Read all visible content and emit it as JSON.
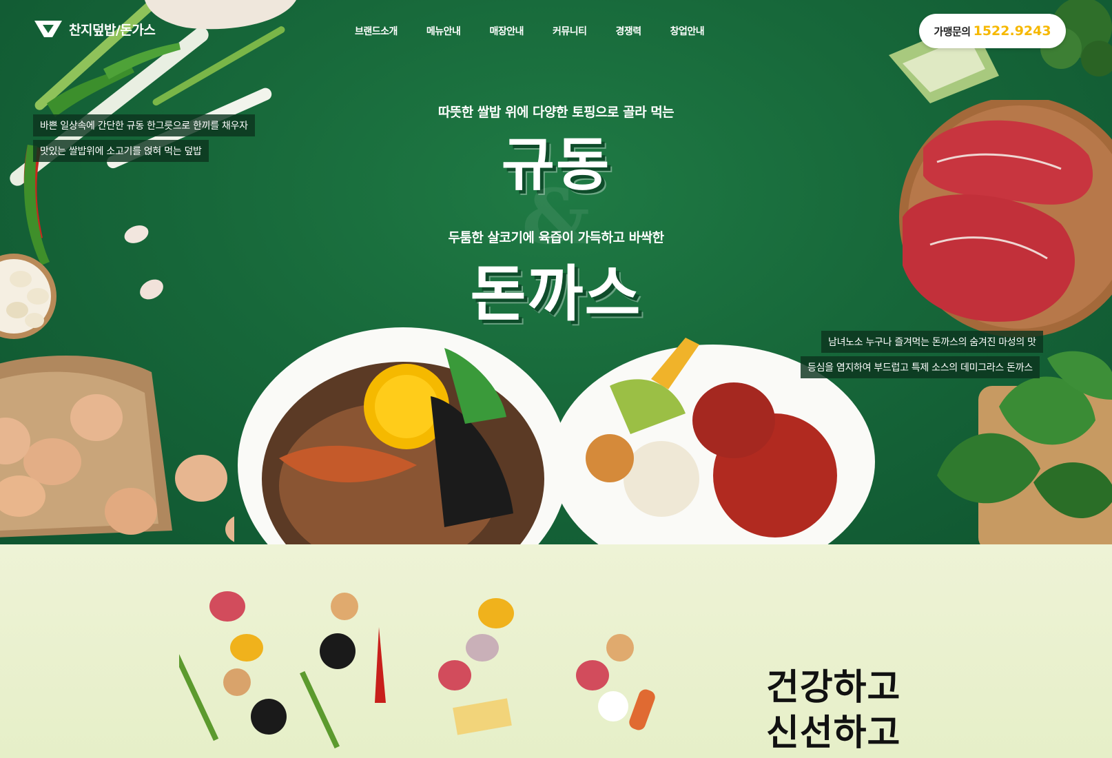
{
  "header": {
    "logo_text": "찬지덮밥/돈가스",
    "nav": [
      "브랜드소개",
      "메뉴안내",
      "매장안내",
      "커뮤니티",
      "경쟁력",
      "창업안내"
    ],
    "franchise_label": "가맹문의",
    "franchise_phone": "1522.9243"
  },
  "hero": {
    "left_taglines": [
      "바쁜 일상속에 간단한 규동 한그릇으로 한끼를 채우자",
      "맛있는 쌀밥위에 소고기를 얹혀 먹는 덮밥"
    ],
    "right_taglines": [
      "남녀노소 누구나 즐겨먹는 돈까스의 숨겨진 마성의 맛",
      "등심을 염지하여 부드럽고 특제 소스의 데미그라스 돈까스"
    ],
    "subtitle1": "따뜻한 쌀밥 위에 다양한 토핑으로 골라 먹는",
    "title1": "규동",
    "ampersand": "&",
    "subtitle2": "두툼한 살코기에 육즙이 가득하고 바싹한",
    "title2": "돈까스"
  },
  "section2": {
    "heading_line1": "건강하고",
    "heading_line2": "신선하고"
  },
  "colors": {
    "hero_green": "#17683a",
    "accent_yellow": "#f6b800",
    "section2_bg": "#e9f0cc"
  }
}
